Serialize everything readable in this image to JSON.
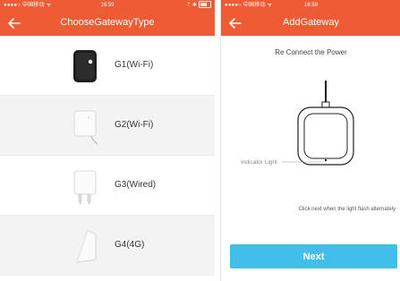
{
  "colors": {
    "header": "#ef5b34",
    "button": "#3fbfe9",
    "stripe": "#f3f3f3"
  },
  "left_screen": {
    "status": {
      "carrier": "●●●●○ 中国移动 ᯤ",
      "time": "16:59",
      "right": "⇡ ✱"
    },
    "title": "ChooseGatewayType",
    "items": [
      {
        "label": "G1(Wi-Fi)",
        "icon": "black-gateway-device"
      },
      {
        "label": "G2(Wi-Fi)",
        "icon": "white-plug-gateway"
      },
      {
        "label": "G3(Wired)",
        "icon": "white-wired-gateway"
      },
      {
        "label": "G4(4G)",
        "icon": "white-4g-gateway"
      }
    ]
  },
  "right_screen": {
    "status": {
      "carrier": "●●●●○ 中国移动 ᯤ",
      "time": "16:59"
    },
    "title": "AddGateway",
    "step_title": "Re Connect the Power",
    "indicator_label": "Indicator Light",
    "hint": "Click next when the light flash alternately",
    "next_label": "Next"
  }
}
